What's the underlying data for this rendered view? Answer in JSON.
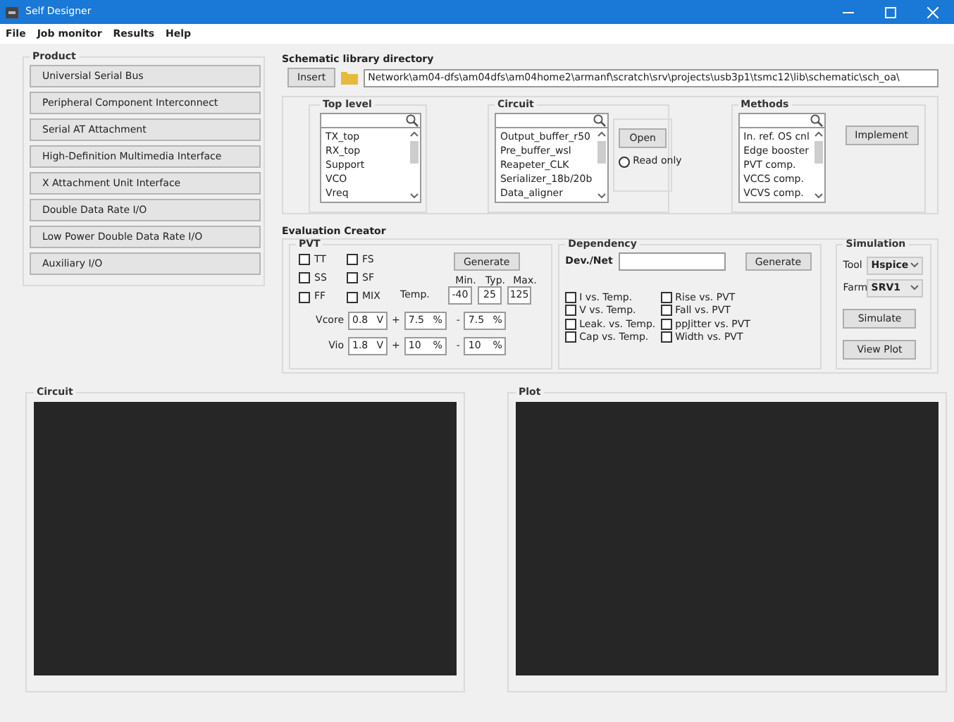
{
  "window": {
    "title": "Self Designer"
  },
  "menu": [
    {
      "label": "File"
    },
    {
      "label": "Job monitor"
    },
    {
      "label": "Results"
    },
    {
      "label": "Help"
    }
  ],
  "product": {
    "title": "Product",
    "buttons": [
      {
        "label": "Universial Serial Bus"
      },
      {
        "label": "Peripheral Component Interconnect"
      },
      {
        "label": "Serial AT Attachment"
      },
      {
        "label": "High-Definition Multimedia Interface"
      },
      {
        "label": "X Attachment Unit Interface"
      },
      {
        "label": "Double Data Rate I/O"
      },
      {
        "label": "Low Power Double Data Rate I/O"
      },
      {
        "label": "Auxiliary I/O"
      }
    ]
  },
  "schematic": {
    "title": "Schematic library directory",
    "insert_button": "Insert",
    "path": "Network\\am04-dfs\\am04dfs\\am04home2\\armanf\\scratch\\srv\\projects\\usb3p1\\tsmc12\\lib\\schematic\\sch_oa\\"
  },
  "top_level": {
    "title": "Top level",
    "items": [
      "TX_top",
      "RX_top",
      "Support",
      "VCO",
      "Vreq"
    ]
  },
  "circuit": {
    "title": "Circuit",
    "items": [
      "Output_buffer_r50",
      "Pre_buffer_wsl",
      "Reapeter_CLK",
      "Serializer_18b/20b",
      "Data_aligner"
    ],
    "open_button": "Open",
    "read_only": {
      "label": "Read only",
      "selected": false
    }
  },
  "methods": {
    "title": "Methods",
    "items": [
      "In. ref. OS cnl",
      "Edge booster",
      "PVT comp.",
      "VCCS comp.",
      "VCVS comp."
    ],
    "implement_button": "Implement"
  },
  "evaluation": {
    "title": "Evaluation Creator",
    "pvt": {
      "title": "PVT",
      "corners": [
        {
          "label": "TT",
          "checked": false
        },
        {
          "label": "FS",
          "checked": false
        },
        {
          "label": "SS",
          "checked": false
        },
        {
          "label": "SF",
          "checked": false
        },
        {
          "label": "FF",
          "checked": false
        },
        {
          "label": "MIX",
          "checked": false
        }
      ],
      "generate_button": "Generate",
      "temp_label": "Temp.",
      "temp_headers": [
        "Min.",
        "Typ.",
        "Max."
      ],
      "temp_values": [
        "-40",
        "25",
        "125"
      ],
      "supplies": [
        {
          "label": "Vcore",
          "value": "0.8",
          "unit": "V",
          "plus_sign": "+",
          "plus": "7.5",
          "minus_sign": "-",
          "minus": "7.5",
          "pct": "%"
        },
        {
          "label": "Vio",
          "value": "1.8",
          "unit": "V",
          "plus_sign": "+",
          "plus": "10",
          "minus_sign": "-",
          "minus": "10",
          "pct": "%"
        }
      ]
    },
    "dependency": {
      "title": "Dependency",
      "field_label": "Dev./Net",
      "generate_button": "Generate",
      "checks": [
        {
          "label": "I vs. Temp.",
          "checked": false
        },
        {
          "label": "Rise vs. PVT",
          "checked": false
        },
        {
          "label": "V vs. Temp.",
          "checked": false
        },
        {
          "label": "Fall vs. PVT",
          "checked": false
        },
        {
          "label": "Leak. vs. Temp.",
          "checked": false
        },
        {
          "label": "ppJitter vs. PVT",
          "checked": false
        },
        {
          "label": "Cap vs. Temp.",
          "checked": false
        },
        {
          "label": "Width vs. PVT",
          "checked": false
        }
      ]
    },
    "simulation": {
      "title": "Simulation",
      "tool_label": "Tool",
      "tool": "Hspice",
      "farm_label": "Farm",
      "farm": "SRV1",
      "buttons": [
        "Simulate",
        "View Plot"
      ]
    }
  },
  "circuit_view": {
    "title": "Circuit"
  },
  "plot_view": {
    "title": "Plot"
  }
}
